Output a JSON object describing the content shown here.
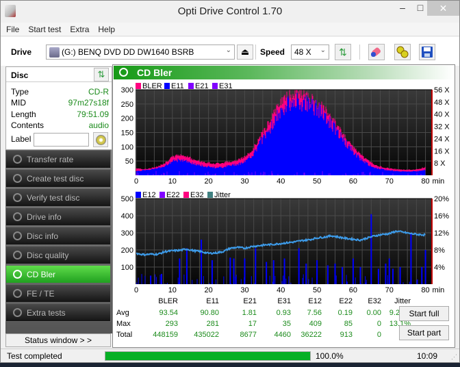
{
  "window": {
    "title": "Opti Drive Control 1.70",
    "minimize": "–",
    "maximize": "□",
    "close": "✕"
  },
  "menu": [
    "File",
    "Start test",
    "Extra",
    "Help"
  ],
  "toolbar": {
    "drive_label": "Drive",
    "drive_value": "(G:)   BENQ DVD DD DW1640 BSRB",
    "speed_label": "Speed",
    "speed_value": "48 X",
    "eject_icon": "⏏"
  },
  "disc": {
    "title": "Disc",
    "rows": [
      {
        "key": "Type",
        "value": "CD-R"
      },
      {
        "key": "MID",
        "value": "97m27s18f"
      },
      {
        "key": "Length",
        "value": "79:51.09"
      },
      {
        "key": "Contents",
        "value": "audio"
      }
    ],
    "label_key": "Label",
    "label_value": ""
  },
  "nav": [
    {
      "label": "Transfer rate",
      "active": false
    },
    {
      "label": "Create test disc",
      "active": false
    },
    {
      "label": "Verify test disc",
      "active": false
    },
    {
      "label": "Drive info",
      "active": false
    },
    {
      "label": "Disc info",
      "active": false
    },
    {
      "label": "Disc quality",
      "active": false
    },
    {
      "label": "CD Bler",
      "active": true
    },
    {
      "label": "FE / TE",
      "active": false
    },
    {
      "label": "Extra tests",
      "active": false
    }
  ],
  "status_window_button": "Status window > >",
  "panel": {
    "title": "CD Bler"
  },
  "chart_data": [
    {
      "type": "bar",
      "title": "BLER / E11 / E21 / E31",
      "legend": [
        {
          "name": "BLER",
          "color": "#ff0080"
        },
        {
          "name": "E11",
          "color": "#0000ff"
        },
        {
          "name": "E21",
          "color": "#8000ff"
        },
        {
          "name": "E31",
          "color": "#8000ff"
        }
      ],
      "legend_placement": "top-left",
      "xlabel": "min",
      "xlim": [
        0,
        80
      ],
      "xticks": [
        0,
        10,
        20,
        30,
        40,
        50,
        60,
        70,
        80
      ],
      "ylim": [
        0,
        300
      ],
      "yticks": [
        50,
        100,
        150,
        200,
        250,
        300
      ],
      "y2ticks": [
        "8 X",
        "16 X",
        "24 X",
        "32 X",
        "40 X",
        "48 X",
        "56 X"
      ],
      "grid": true,
      "series": [
        {
          "name": "E11 (approx envelope)",
          "x": [
            0,
            2,
            4,
            6,
            8,
            10,
            12,
            14,
            16,
            18,
            20,
            22,
            24,
            26,
            28,
            30,
            32,
            34,
            36,
            38,
            40,
            42,
            44,
            46,
            48,
            50,
            52,
            54,
            56,
            58,
            60,
            62,
            64,
            66,
            68,
            70,
            72,
            74,
            76,
            78,
            80
          ],
          "values": [
            15,
            18,
            20,
            25,
            35,
            50,
            55,
            50,
            40,
            35,
            30,
            28,
            30,
            35,
            40,
            48,
            70,
            110,
            150,
            190,
            230,
            255,
            265,
            262,
            255,
            240,
            215,
            185,
            150,
            115,
            85,
            60,
            40,
            28,
            22,
            18,
            15,
            14,
            14,
            15,
            20
          ]
        },
        {
          "name": "BLER peaks (approx)",
          "x": [
            0,
            2,
            4,
            6,
            8,
            10,
            12,
            14,
            16,
            18,
            20,
            22,
            24,
            26,
            28,
            30,
            32,
            34,
            36,
            38,
            40,
            42,
            44,
            46,
            48,
            50,
            52,
            54,
            56,
            58,
            60,
            62,
            64,
            66,
            68,
            70,
            72,
            74,
            76,
            78,
            80
          ],
          "values": [
            25,
            22,
            25,
            32,
            45,
            65,
            75,
            68,
            55,
            50,
            45,
            42,
            45,
            50,
            55,
            65,
            90,
            130,
            175,
            220,
            265,
            285,
            293,
            290,
            280,
            262,
            240,
            205,
            170,
            135,
            100,
            75,
            55,
            38,
            30,
            25,
            22,
            20,
            20,
            22,
            30
          ]
        }
      ]
    },
    {
      "type": "bar",
      "title": "E12 / E22 / E32 / Jitter",
      "legend": [
        {
          "name": "E12",
          "color": "#0000ff"
        },
        {
          "name": "E22",
          "color": "#8000ff"
        },
        {
          "name": "E32",
          "color": "#ff0080"
        },
        {
          "name": "Jitter",
          "color": "#408080"
        }
      ],
      "legend_placement": "top-left",
      "xlabel": "min",
      "xlim": [
        0,
        80
      ],
      "xticks": [
        0,
        10,
        20,
        30,
        40,
        50,
        60,
        70,
        80
      ],
      "ylim": [
        0,
        500
      ],
      "yticks": [
        100,
        200,
        300,
        400,
        500
      ],
      "y2lim": [
        0,
        20
      ],
      "y2ticks": [
        "4%",
        "8%",
        "12%",
        "16%",
        "20%"
      ],
      "grid": true,
      "series": [
        {
          "name": "Jitter (%)",
          "x": [
            0,
            2,
            4,
            6,
            8,
            10,
            12,
            14,
            16,
            18,
            20,
            22,
            24,
            26,
            28,
            30,
            32,
            34,
            36,
            38,
            40,
            42,
            44,
            46,
            48,
            50,
            52,
            54,
            56,
            58,
            60,
            62,
            64,
            66,
            68,
            70,
            72,
            74,
            76,
            78,
            80
          ],
          "values": [
            7.2,
            6.9,
            7.0,
            7.0,
            7.6,
            7.8,
            7.9,
            8.2,
            7.8,
            7.6,
            7.2,
            7.3,
            7.6,
            8.4,
            8.6,
            8.4,
            8.8,
            9.0,
            9.2,
            9.3,
            9.5,
            9.7,
            9.9,
            10.2,
            10.4,
            10.8,
            11.0,
            11.3,
            11.0,
            10.7,
            10.5,
            10.3,
            10.8,
            11.3,
            11.6,
            11.8,
            12.4,
            12.1,
            11.8,
            11.6,
            11.5
          ]
        },
        {
          "name": "E12 spikes",
          "x": [
            4,
            7,
            12,
            14,
            18,
            21,
            26,
            27,
            30,
            33,
            36,
            38,
            41,
            45,
            47,
            50,
            53,
            55,
            57,
            60,
            62,
            65,
            67,
            69,
            70,
            71,
            73,
            76,
            79,
            80
          ],
          "values": [
            50,
            60,
            150,
            210,
            260,
            140,
            155,
            150,
            150,
            210,
            130,
            140,
            150,
            210,
            120,
            140,
            110,
            120,
            100,
            150,
            100,
            409,
            90,
            120,
            150,
            90,
            100,
            300,
            100,
            200
          ]
        }
      ]
    }
  ],
  "stats": {
    "columns": [
      "BLER",
      "E11",
      "E21",
      "E31",
      "E12",
      "E22",
      "E32",
      "Jitter"
    ],
    "rows": [
      {
        "label": "Avg",
        "values": [
          "93.54",
          "90.80",
          "1.81",
          "0.93",
          "7.56",
          "0.19",
          "0.00",
          "9.26%"
        ]
      },
      {
        "label": "Max",
        "values": [
          "293",
          "281",
          "17",
          "35",
          "409",
          "85",
          "0",
          "13.1%"
        ]
      },
      {
        "label": "Total",
        "values": [
          "448159",
          "435022",
          "8677",
          "4460",
          "36222",
          "913",
          "0",
          ""
        ]
      }
    ]
  },
  "buttons": {
    "start_full": "Start full",
    "start_part": "Start part"
  },
  "statusbar": {
    "text": "Test completed",
    "progress_percent": 100,
    "progress_label": "100.0%",
    "time": "10:09"
  },
  "colors": {
    "accent_green": "#1a8a1a",
    "progress": "#06b025",
    "bler": "#ff0080",
    "e11": "#0000ff",
    "jitter": "#3d9be9"
  }
}
